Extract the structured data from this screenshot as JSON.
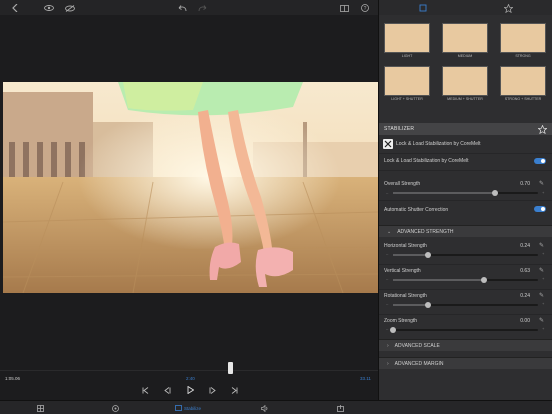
{
  "presets": [
    {
      "label": "LIGHT"
    },
    {
      "label": "MEDIUM"
    },
    {
      "label": "STRONG"
    },
    {
      "label": "LIGHT + SHUTTER"
    },
    {
      "label": "MEDIUM + SHUTTER"
    },
    {
      "label": "STRONG + SHUTTER"
    }
  ],
  "stabilizer": {
    "header": "STABILIZER",
    "plugin_name": "Lock & Load Stabilization by CoreMelt",
    "enable_label": "Lock & Load Stabilization by CoreMelt",
    "enabled": true,
    "overall_strength": {
      "label": "Overall Strength",
      "value": "0.70",
      "fraction": 0.7
    },
    "shutter_label": "Automatic Shutter Correction",
    "shutter_enabled": true
  },
  "advanced_strength": {
    "header": "ADVANCED STRENGTH",
    "sliders": [
      {
        "label": "Horizontal Strength",
        "value": "0.24",
        "fraction": 0.24
      },
      {
        "label": "Vertical Strength",
        "value": "0.63",
        "fraction": 0.63
      },
      {
        "label": "Rotational Strength",
        "value": "0.24",
        "fraction": 0.24
      },
      {
        "label": "Zoom Strength",
        "value": "0.00",
        "fraction": 0.0
      }
    ]
  },
  "advanced_scale": {
    "header": "ADVANCED SCALE"
  },
  "advanced_margin": {
    "header": "ADVANCED MARGIN"
  },
  "timeline": {
    "start_time": "1:05.06",
    "current_time": "2:40",
    "end_time": "33.11"
  },
  "bottom": {
    "active_tab": "Stabilize"
  },
  "colors": {
    "accent": "#3a7fcf",
    "panel": "#2e2e30",
    "header": "#444446"
  }
}
